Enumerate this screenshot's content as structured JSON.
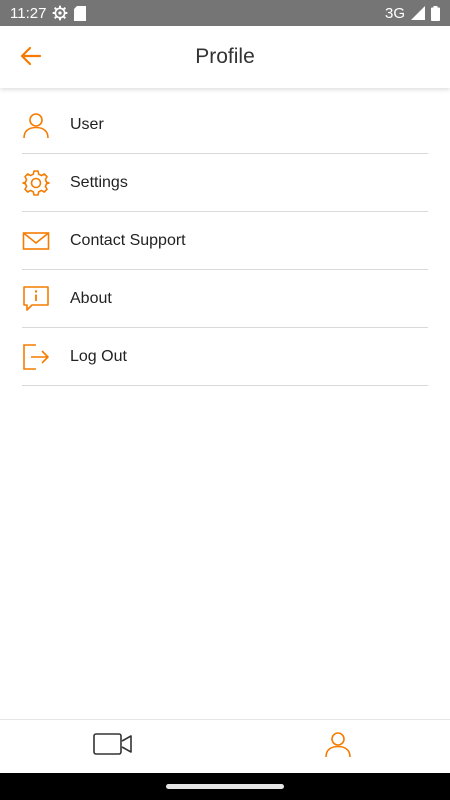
{
  "status_bar": {
    "time": "11:27",
    "network": "3G",
    "icons": [
      "settings-gear-icon",
      "sd-card-icon",
      "signal-icon",
      "battery-icon"
    ]
  },
  "header": {
    "title": "Profile",
    "back_icon": "arrow-left-icon"
  },
  "menu": {
    "items": [
      {
        "label": "User",
        "icon": "user-icon"
      },
      {
        "label": "Settings",
        "icon": "gear-icon"
      },
      {
        "label": "Contact Support",
        "icon": "envelope-icon"
      },
      {
        "label": "About",
        "icon": "info-bubble-icon"
      },
      {
        "label": "Log Out",
        "icon": "logout-icon"
      }
    ]
  },
  "bottom_nav": {
    "tabs": [
      {
        "icon": "video-camera-icon",
        "active": false
      },
      {
        "icon": "user-icon",
        "active": true
      }
    ]
  },
  "colors": {
    "accent": "#f57c00",
    "status_bar": "#757575",
    "text": "#222222",
    "divider": "#d9d9d9",
    "inactive_icon": "#333333"
  }
}
